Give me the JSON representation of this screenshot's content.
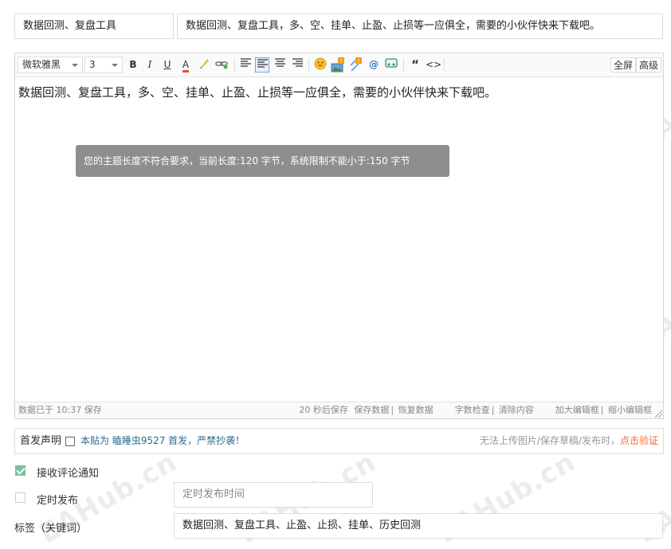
{
  "post": {
    "category": "数据回测、复盘工具",
    "title": "数据回测、复盘工具，多、空、挂单、止盈、止损等一应俱全，需要的小伙伴快来下载吧。"
  },
  "editor": {
    "font_family": "微软雅黑",
    "font_size": "3",
    "toolbar": {
      "bold": "B",
      "italic": "I",
      "underline": "U",
      "font_color": "A",
      "quote": "“",
      "code": "<>",
      "fullscreen": "全屏",
      "advanced": "高级"
    },
    "content": "数据回测、复盘工具，多、空、挂单、止盈、止损等一应俱全，需要的小伙伴快来下载吧。",
    "tooltip": "您的主题长度不符合要求，当前长度:120 字节，系统限制不能小于:150 字节",
    "status": {
      "saved": "数据已于 10:37 保存",
      "autosave": "20 秒后保存",
      "save_data": "保存数据",
      "restore_data": "恢复数据",
      "word_check": "字数检查",
      "clear_content": "清除内容",
      "enlarge": "加大编辑框",
      "shrink": "缩小编辑框"
    }
  },
  "declare": {
    "label": "首发声明",
    "note": "本贴为 瞌睡虫9527 首发，严禁抄袭！",
    "hint": "无法上传图片/保存草稿/发布时，",
    "verify_link": "点击验证"
  },
  "options": {
    "notify_label": "接收评论通知",
    "notify_checked": true,
    "schedule_label": "定时发布",
    "schedule_checked": false,
    "schedule_placeholder": "定时发布时间",
    "tags_label": "标签（关键词）",
    "tags_value": "数据回测、复盘工具、止盈、止损、挂单、历史回测"
  },
  "watermark": "EAHub.cn",
  "colors": {
    "accent_green": "#7bbfa1",
    "warn_orange": "#f56a3a",
    "note_blue": "#2a6b8f"
  }
}
